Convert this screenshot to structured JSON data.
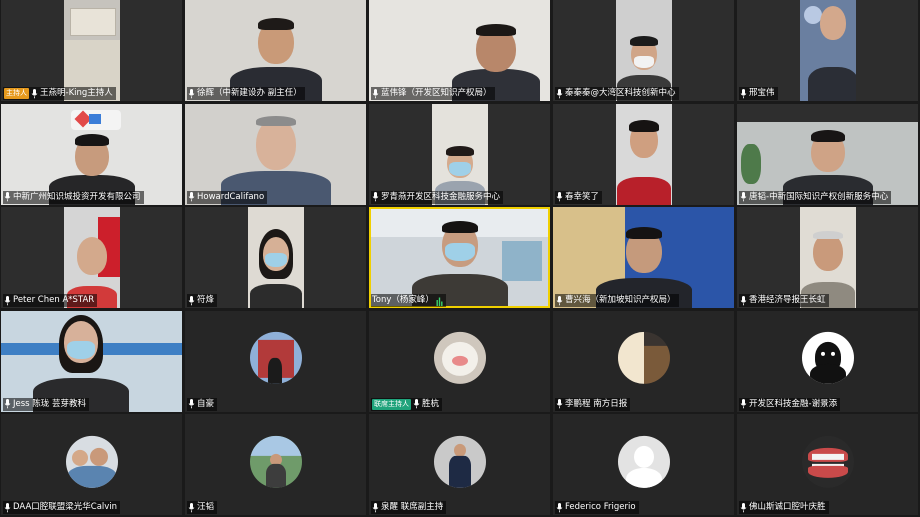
{
  "colors": {
    "tile_bg": "#262626",
    "host_badge": "#e69a1e",
    "cohost_badge": "#1fa37b",
    "label_text": "#ffffff"
  },
  "participants": [
    {
      "name": "王燕明-King主持人",
      "badge": "主持人",
      "mic": "mic-icon"
    },
    {
      "name": "徐辉（中新建设办 副主任）",
      "mic": "mic-icon"
    },
    {
      "name": "蓝伟锋（开发区知识产权局）",
      "mic": "mic-icon"
    },
    {
      "name": "秦秦秦@大湾区科技创新中心",
      "mic": "mic-icon"
    },
    {
      "name": "邢宝伟",
      "mic": "mic-icon"
    },
    {
      "name": "中新广州知识城投资开发有限公司",
      "mic": "mic-icon"
    },
    {
      "name": "HowardCalifano",
      "mic": "mic-icon"
    },
    {
      "name": "罗青燕开发区科技金融服务中心",
      "mic": "mic-icon"
    },
    {
      "name": "春幸笑了",
      "mic": "mic-icon"
    },
    {
      "name": "唐韬-中新国际知识产权创新服务中心",
      "mic": "mic-icon"
    },
    {
      "name": "Peter Chen A*STAR",
      "mic": "mic-icon"
    },
    {
      "name": "符烽",
      "mic": "mic-icon"
    },
    {
      "name": "Tony（杨家峰）",
      "mic": "mic-active-icon"
    },
    {
      "name": "曹兴海（新加坡知识产权局）",
      "mic": "mic-icon"
    },
    {
      "name": "香港经济导报王长虹",
      "mic": "mic-icon"
    },
    {
      "name": "Jess 陈珑 芸芽教科",
      "mic": "mic-icon"
    },
    {
      "name": "自豪",
      "mic": "mic-icon"
    },
    {
      "name": "胜杭",
      "badge": "联席主持人",
      "mic": "mic-icon"
    },
    {
      "name": "李鹏程 南方日报",
      "mic": "mic-icon"
    },
    {
      "name": "开发区科技金融-谢景添",
      "mic": "mic-icon"
    },
    {
      "name": "DAA口腔联盟梁光华Calvin",
      "mic": "mic-icon"
    },
    {
      "name": "汪韬",
      "mic": "mic-icon"
    },
    {
      "name": "泉醒 联席副主持",
      "mic": "mic-icon"
    },
    {
      "name": "Federico Frigerio",
      "mic": "mic-icon"
    },
    {
      "name": "佛山斯诚口腔叶庆胜",
      "mic": "mic-icon"
    }
  ]
}
